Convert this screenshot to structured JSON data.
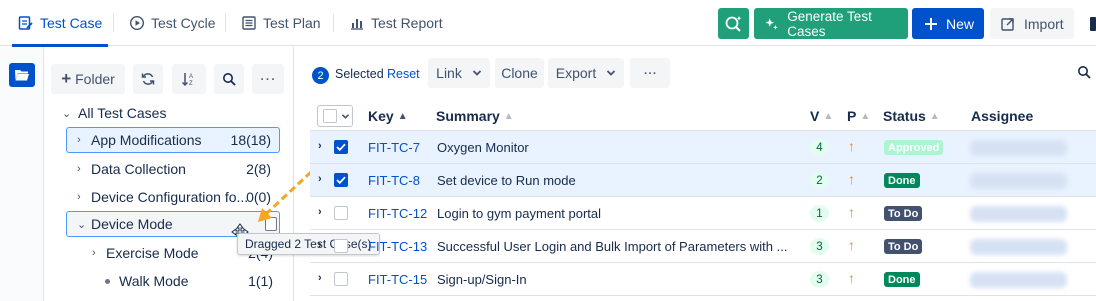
{
  "tabs": [
    {
      "label": "Test Case",
      "icon": "test-case-icon",
      "active": true
    },
    {
      "label": "Test Cycle",
      "icon": "cycle-icon",
      "active": false
    },
    {
      "label": "Test Plan",
      "icon": "plan-icon",
      "active": false
    },
    {
      "label": "Test Report",
      "icon": "report-chart-icon",
      "active": false
    }
  ],
  "header_actions": {
    "generate_label": "Generate Test Cases",
    "new_label": "New",
    "import_label": "Import"
  },
  "tree": {
    "toolbar": {
      "folder_label": "Folder"
    },
    "root_label": "All Test Cases",
    "items": [
      {
        "label": "App Modifications",
        "count": "18(18)"
      },
      {
        "label": "Data Collection",
        "count": "2(8)"
      },
      {
        "label": "Device Configuration fo...",
        "count": "0(0)"
      },
      {
        "label": "Device Mode",
        "count": ""
      },
      {
        "label": "Exercise Mode",
        "count": "2(4)"
      },
      {
        "label": "Walk Mode",
        "count": "1(1)"
      }
    ],
    "drag_tooltip": "Dragged 2 Test Case(s)"
  },
  "toolbar": {
    "selected_count": "2",
    "selected_label": "Selected",
    "reset_label": "Reset",
    "link_label": "Link",
    "clone_label": "Clone",
    "export_label": "Export"
  },
  "table": {
    "columns": {
      "key": "Key",
      "summary": "Summary",
      "version": "V",
      "priority": "P",
      "status": "Status",
      "assignee": "Assignee"
    },
    "rows": [
      {
        "key": "FIT-TC-7",
        "summary": "Oxygen Monitor",
        "version": "4",
        "priority": "↑",
        "status": "Approved",
        "status_color": "#abf5d1",
        "selected": true
      },
      {
        "key": "FIT-TC-8",
        "summary": "Set device to Run mode",
        "version": "2",
        "priority": "↑",
        "status": "Done",
        "status_color": "#00875a",
        "selected": true
      },
      {
        "key": "FIT-TC-12",
        "summary": "Login to gym payment portal",
        "version": "1",
        "priority": "↑",
        "status": "To Do",
        "status_color": "#42526e",
        "selected": false
      },
      {
        "key": "FIT-TC-13",
        "summary": "Successful User Login and Bulk Import of Parameters with ...",
        "version": "3",
        "priority": "↑",
        "status": "To Do",
        "status_color": "#42526e",
        "selected": false
      },
      {
        "key": "FIT-TC-15",
        "summary": "Sign-up/Sign-In",
        "version": "3",
        "priority": "↑",
        "status": "Done",
        "status_color": "#00875a",
        "selected": false
      }
    ]
  }
}
